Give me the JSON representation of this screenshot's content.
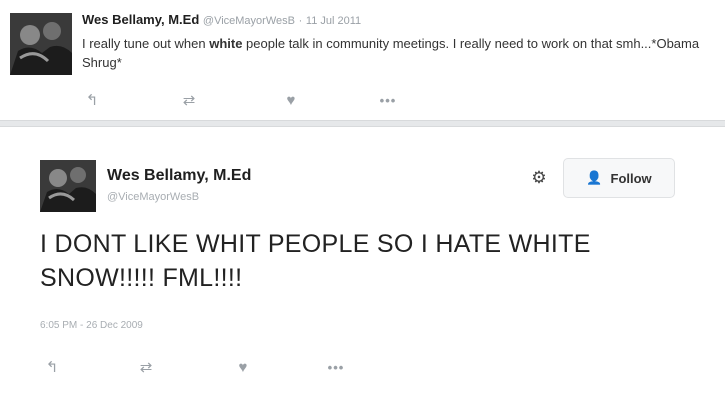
{
  "tweet1": {
    "name": "Wes Bellamy, M.Ed",
    "handle": "@ViceMayorWesB",
    "separator": "·",
    "date": "11 Jul 2011",
    "text_part1": "I really tune out when ",
    "text_bold": "white",
    "text_part2": " people talk in community meetings. I really need to work on that smh...*Obama Shrug*",
    "actions": {
      "reply": "↰",
      "retweet": "⇄",
      "like": "♥",
      "more": "•••"
    }
  },
  "tweet2": {
    "name": "Wes Bellamy, M.Ed",
    "handle": "@ViceMayorWesB",
    "follow_label": "Follow",
    "text": "I DONT LIKE WHIT PEOPLE SO I HATE WHITE SNOW!!!!! FML!!!!",
    "timestamp": "6:05 PM - 26 Dec 2009",
    "actions": {
      "reply": "↰",
      "retweet": "⇄",
      "like": "♥",
      "more": "•••"
    }
  },
  "icons": {
    "gear": "⚙",
    "follow_person": "👤"
  }
}
